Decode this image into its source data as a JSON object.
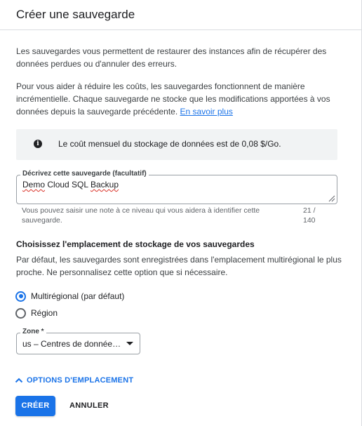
{
  "dialog": {
    "title": "Créer une sauvegarde"
  },
  "intro": {
    "paragraph1": "Les sauvegardes vous permettent de restaurer des instances afin de récupérer des données perdues ou d'annuler des erreurs.",
    "paragraph2": "Pour vous aider à réduire les coûts, les sauvegardes fonctionnent de manière incrémentielle. Chaque sauvegarde ne stocke que les modifications apportées à vos données depuis la sauvegarde précédente.",
    "learn_more": "En savoir plus"
  },
  "info": {
    "icon": "info-icon",
    "text": "Le coût mensuel du stockage de données est de 0,08 $/Go."
  },
  "description": {
    "label": "Décrivez cette sauvegarde (facultatif)",
    "value_part1": "Demo",
    "value_part2": "Cloud SQL",
    "value_part3": "Backup",
    "helper": "Vous pouvez saisir une note à ce niveau qui vous aidera à identifier cette sauvegarde.",
    "counter_line1": "21 /",
    "counter_line2": "140"
  },
  "location": {
    "heading": "Choisissez l'emplacement de stockage de vos sauvegardes",
    "description": "Par défaut, les sauvegardes sont enregistrées dans l'emplacement multirégional le plus proche. Ne personnalisez cette option que si nécessaire.",
    "options": [
      {
        "label": "Multirégional (par défaut)",
        "checked": true
      },
      {
        "label": "Région",
        "checked": false
      }
    ],
    "zone_label": "Zone *",
    "zone_value": "us – Centres de données dans plusieurs régions aux États-Unis",
    "toggle_label": "OPTIONS D'EMPLACEMENT"
  },
  "actions": {
    "create": "CRÉER",
    "cancel": "ANNULER"
  },
  "colors": {
    "accent": "#1a73e8",
    "info_bg": "#f1f3f4",
    "error_underline": "#d93025"
  }
}
